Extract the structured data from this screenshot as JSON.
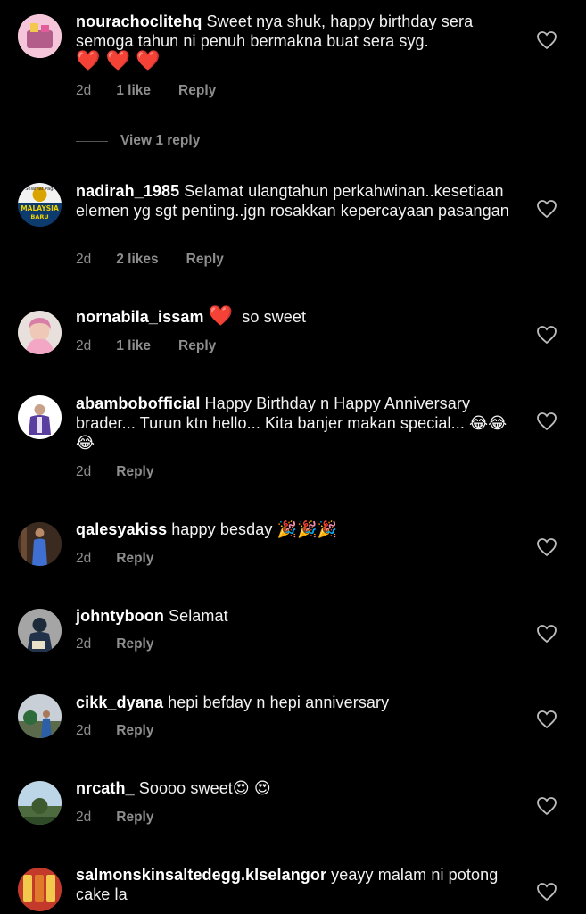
{
  "comments": [
    {
      "username": "nourachoclitehq",
      "text": "Sweet nya shuk, happy birthday sera semoga tahun ni penuh bermakna buat sera syg.",
      "emoji": "❤️ ❤️ ❤️",
      "time": "2d",
      "likes": "1 like",
      "reply": "Reply",
      "view_replies": "View 1 reply"
    },
    {
      "username": "nadirah_1985",
      "text": "Selamat ulangtahun perkahwinan..kesetiaan elemen yg sgt penting..jgn rosakkan kepercayaan pasangan",
      "time": "2d",
      "likes": "2 likes",
      "reply": "Reply"
    },
    {
      "username": "nornabila_issam",
      "text": "so sweet",
      "emoji": "❤️",
      "time": "2d",
      "likes": "1 like",
      "reply": "Reply"
    },
    {
      "username": "abambobofficial",
      "text": "Happy Birthday n Happy Anniversary brader... Turun ktn hello... Kita banjer makan special...",
      "emoji": "😂😂😂",
      "time": "2d",
      "reply": "Reply"
    },
    {
      "username": "qalesyakiss",
      "text": "happy besday",
      "emoji": "🎉🎉🎉",
      "time": "2d",
      "reply": "Reply"
    },
    {
      "username": "johntyboon",
      "text": "Selamat",
      "time": "2d",
      "reply": "Reply"
    },
    {
      "username": "cikk_dyana",
      "text": "hepi befday n hepi anniversary",
      "time": "2d",
      "reply": "Reply"
    },
    {
      "username": "nrcath_",
      "text": "Soooo sweet",
      "emoji": "😍 😍",
      "time": "2d",
      "reply": "Reply"
    },
    {
      "username": "salmonskinsaltedegg.klselangor",
      "text": "yeayy malam ni potong cake la"
    }
  ],
  "avatar_labels": {
    "nadirah_1985_line1": "Selamat Pagi",
    "nadirah_1985_line2": "MALAYSIA",
    "nadirah_1985_line3": "BARU"
  },
  "colors": {
    "background": "#000000",
    "text": "#f5f5f5",
    "muted": "#8e8e8e",
    "heart_red": "#e8303a"
  },
  "icons": {
    "like": "heart-outline-icon"
  }
}
